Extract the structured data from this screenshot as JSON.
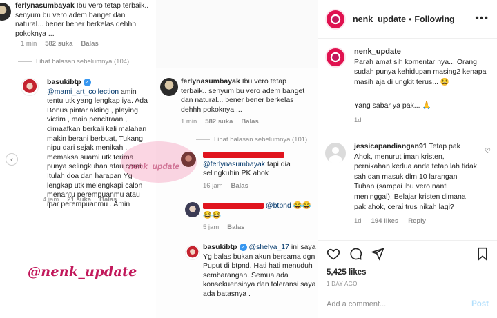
{
  "post_image": {
    "top_panel": {
      "username": "ferlynasumbayak",
      "text": "Ibu vero tetap terbaik.. senyum bu vero adem banget dan natural... bener bener berkelas dehhh pokoknya ...",
      "time": "1 min",
      "likes": "582 suka",
      "reply": "Balas"
    },
    "left_view_prev": "Lihat balasan sebelumnya (104)",
    "left_comment": {
      "username": "basukibtp",
      "mention": "@mami_art_collection",
      "text": "amin tentu utk yang lengkap iya. Ada Bonus pintar akting , playing  victim , main pencitraan , dimaafkan berkali kali malahan makin berani berbuat, Tukang nipu dari sejak menikah , memaksa suami utk terima punya selingkuhan atau cerai . Itulah doa dan harapan Yg lengkap utk melengkapi calon menantu perempuanmu atau ipar perempuanmu . Amin",
      "time": "4 jam",
      "likes": "21 suka",
      "reply": "Balas"
    },
    "right_top": {
      "username": "ferlynasumbayak",
      "text": "Ibu vero tetap terbaik.. senyum bu vero adem banget dan natural... bener bener berkelas dehhh pokoknya ...",
      "time": "1 min",
      "likes": "582 suka",
      "reply": "Balas"
    },
    "right_view_prev": "Lihat balasan sebelumnya (101)",
    "reply_1": {
      "mention": "@ferlynasumbayak",
      "text": "tapi dia selingkuhin PK ahok",
      "time": "16 jam",
      "reply": "Balas"
    },
    "reply_2": {
      "mention": "@btpnd",
      "text": "😂😂😂😂",
      "time": "5 jam",
      "reply": "Balas"
    },
    "reply_3": {
      "username": "basukibtp",
      "mention": "@shelya_17",
      "text": "ini saya Yg balas bukan akun bersama dgn Puput di btpnd. Hati hati menuduh sembarangan. Semua ada konsekuensinya dan toleransi saya ada batasnya .",
      "time": "4 jam"
    },
    "watermark_center": "nenk_update",
    "watermark_bottom": "@nenk_update"
  },
  "sidebar": {
    "header": {
      "username": "nenk_update",
      "separator": "•",
      "follow_status": "Following",
      "more_icon": "more-horizontal-icon"
    },
    "caption": {
      "username": "nenk_update",
      "text": "Parah amat sih komentar nya... Orang sudah punya kehidupan masing2 kenapa masih aja di ungkit terus... 😫",
      "text2": "Yang sabar ya pak... 🙏",
      "time": "1d"
    },
    "comment": {
      "username": "jessicapandiangan91",
      "text": "Tetap pak Ahok, menurut iman kristen, pernikahan kedua anda tetap lah tidak sah dan masuk dlm 10 larangan Tuhan (sampai ibu vero nanti meninggal). Belajar kristen dimana pak ahok, cerai trus nikah lagi?",
      "time": "1d",
      "likes": "194 likes",
      "reply": "Reply"
    },
    "actions": {
      "likes": "5,425 likes",
      "date": "1 DAY AGO"
    },
    "add_comment": {
      "placeholder": "Add a comment...",
      "post_label": "Post"
    }
  },
  "colors": {
    "accent": "#0095f6",
    "redaction": "#e0141e",
    "watermark": "#c2185b",
    "muted": "#8e8e8e"
  }
}
